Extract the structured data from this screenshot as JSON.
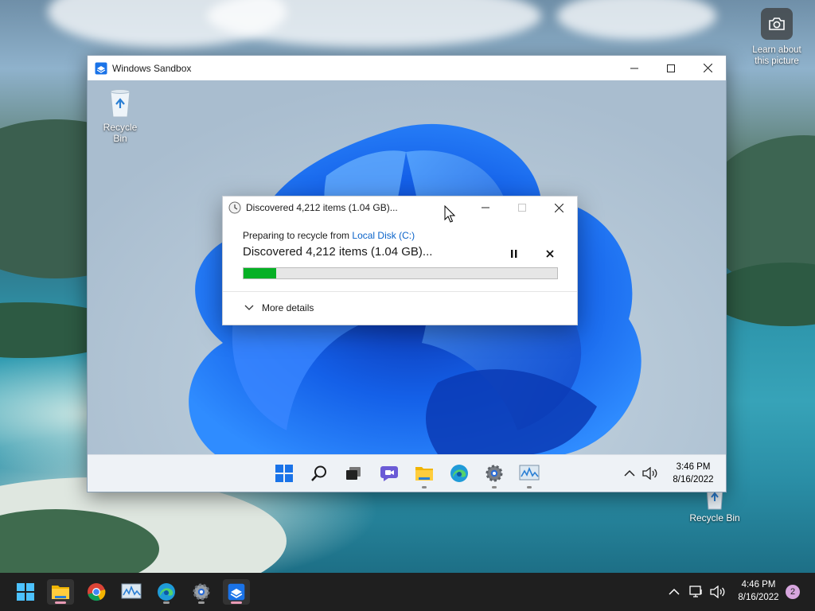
{
  "host": {
    "learn_picture_label": "Learn about this picture",
    "recycle_bin_label": "Recycle Bin",
    "clock_time": "4:46 PM",
    "clock_date": "8/16/2022",
    "notification_count": "2"
  },
  "sandbox": {
    "window_title": "Windows Sandbox",
    "desktop_icon_label": "Recycle Bin",
    "clock_time": "3:46 PM",
    "clock_date": "8/16/2022"
  },
  "dialog": {
    "title": "Discovered 4,212 items (1.04 GB)...",
    "subtitle_prefix": "Preparing to recycle from ",
    "subtitle_link": "Local Disk (C:)",
    "status": "Discovered 4,212 items (1.04 GB)...",
    "progress_percent": 10.5,
    "more_details_label": "More details"
  },
  "colors": {
    "progress_fill": "#06b025",
    "link": "#0a63c9",
    "win_accent": "#1a73e8"
  }
}
